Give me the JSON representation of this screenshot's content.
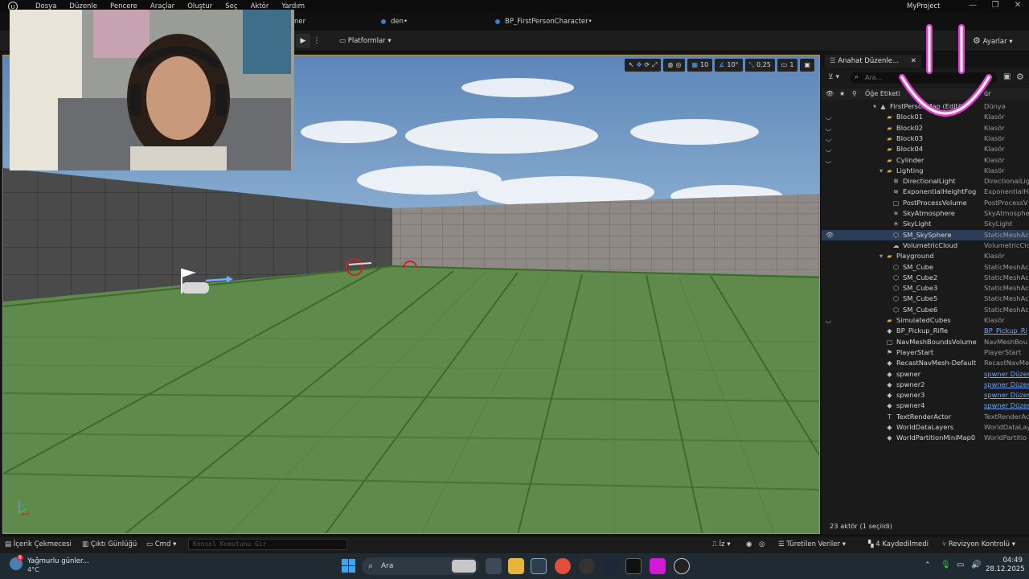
{
  "menu": [
    "Dosya",
    "Düzenle",
    "Pencere",
    "Araçlar",
    "Oluştur",
    "Seç",
    "Aktör",
    "Yardım"
  ],
  "project_name": "MyProject",
  "tabs": [
    {
      "label": "ner"
    },
    {
      "label": "den•"
    },
    {
      "label": "BP_FirstPersonCharacter•"
    }
  ],
  "toolbar": {
    "platforms_label": "Platformlar",
    "settings_label": "Ayarlar"
  },
  "viewport_tools": {
    "grid_snap": "10",
    "rotation_snap": "10°",
    "scale_snap": "0,25",
    "camera_speed": "1"
  },
  "outliner": {
    "tab_label": "Anahat Düzenle...",
    "search_placeholder": "Ara...",
    "col_label": "Öğe Etiketi",
    "col_type_partial": "ür",
    "rows": [
      {
        "name": "FirstPersonMap (Editör)",
        "type": "Dünya",
        "indent": 0,
        "icon": "world",
        "eye": false
      },
      {
        "name": "Block01",
        "type": "Klasör",
        "indent": 1,
        "icon": "folder",
        "eye": true
      },
      {
        "name": "Block02",
        "type": "Klasör",
        "indent": 1,
        "icon": "folder",
        "eye": true
      },
      {
        "name": "Block03",
        "type": "Klasör",
        "indent": 1,
        "icon": "folder",
        "eye": true
      },
      {
        "name": "Block04",
        "type": "Klasör",
        "indent": 1,
        "icon": "folder",
        "eye": true
      },
      {
        "name": "Cylinder",
        "type": "Klasör",
        "indent": 1,
        "icon": "folder",
        "eye": true
      },
      {
        "name": "Lighting",
        "type": "Klasör",
        "indent": 1,
        "icon": "folder",
        "eye": false
      },
      {
        "name": "DirectionalLight",
        "type": "DirectionalLig",
        "indent": 2,
        "icon": "light",
        "eye": false
      },
      {
        "name": "ExponentialHeightFog",
        "type": "ExponentialHe",
        "indent": 2,
        "icon": "fog",
        "eye": false
      },
      {
        "name": "PostProcessVolume",
        "type": "PostProcessV",
        "indent": 2,
        "icon": "volume",
        "eye": false
      },
      {
        "name": "SkyAtmosphere",
        "type": "SkyAtmosphe",
        "indent": 2,
        "icon": "sky",
        "eye": false
      },
      {
        "name": "SkyLight",
        "type": "SkyLight",
        "indent": 2,
        "icon": "sky",
        "eye": false
      },
      {
        "name": "SM_SkySphere",
        "type": "StaticMeshAc",
        "indent": 2,
        "icon": "mesh",
        "eye": true,
        "selected": true
      },
      {
        "name": "VolumetricCloud",
        "type": "VolumetricClo",
        "indent": 2,
        "icon": "cloud",
        "eye": false
      },
      {
        "name": "Playground",
        "type": "Klasör",
        "indent": 1,
        "icon": "folder",
        "eye": false
      },
      {
        "name": "SM_Cube",
        "type": "StaticMeshAc",
        "indent": 2,
        "icon": "mesh",
        "eye": false
      },
      {
        "name": "SM_Cube2",
        "type": "StaticMeshAc",
        "indent": 2,
        "icon": "mesh",
        "eye": false
      },
      {
        "name": "SM_Cube3",
        "type": "StaticMeshAc",
        "indent": 2,
        "icon": "mesh",
        "eye": false
      },
      {
        "name": "SM_Cube5",
        "type": "StaticMeshAc",
        "indent": 2,
        "icon": "mesh",
        "eye": false
      },
      {
        "name": "SM_Cube6",
        "type": "StaticMeshAc",
        "indent": 2,
        "icon": "mesh",
        "eye": false
      },
      {
        "name": "SimulatedCubes",
        "type": "Klasör",
        "indent": 1,
        "icon": "folder",
        "eye": true
      },
      {
        "name": "BP_Pickup_Rifle",
        "type": "BP_Pickup_Ri",
        "indent": 1,
        "icon": "actor",
        "eye": false,
        "link": true
      },
      {
        "name": "NavMeshBoundsVolume",
        "type": "NavMeshBou",
        "indent": 1,
        "icon": "volume",
        "eye": false
      },
      {
        "name": "PlayerStart",
        "type": "PlayerStart",
        "indent": 1,
        "icon": "flag",
        "eye": false
      },
      {
        "name": "RecastNavMesh-Default",
        "type": "RecastNavMe",
        "indent": 1,
        "icon": "actor",
        "eye": false
      },
      {
        "name": "spwner",
        "type": "spwner Düzer",
        "indent": 1,
        "icon": "actor",
        "eye": false,
        "link": true
      },
      {
        "name": "spwner2",
        "type": "spwner Düzer",
        "indent": 1,
        "icon": "actor",
        "eye": false,
        "link": true
      },
      {
        "name": "spwner3",
        "type": "spwner Düzer",
        "indent": 1,
        "icon": "actor",
        "eye": false,
        "link": true
      },
      {
        "name": "spwner4",
        "type": "spwner Düzer",
        "indent": 1,
        "icon": "actor",
        "eye": false,
        "link": true
      },
      {
        "name": "TextRenderActor",
        "type": "TextRenderAc",
        "indent": 1,
        "icon": "text",
        "eye": false
      },
      {
        "name": "WorldDataLayers",
        "type": "WorldDataLay",
        "indent": 1,
        "icon": "actor",
        "eye": false
      },
      {
        "name": "WorldPartitionMiniMap0",
        "type": "WorldPartitio",
        "indent": 1,
        "icon": "actor",
        "eye": false
      }
    ],
    "footer": "23 aktör (1 seçildi)"
  },
  "editor_bottom": {
    "content_drawer": "İçerik Çekmecesi",
    "output_log": "Çıktı Günlüğü",
    "cmd": "Cmd",
    "console_placeholder": "Konsol Komutunu Gir",
    "trace": "İz",
    "derived_data": "Türetilen Veriler",
    "unsaved": "4 Kaydedilmedi",
    "revision_control": "Revizyon Kontrolü"
  },
  "taskbar": {
    "weather_text": "Yağmurlu günler...",
    "weather_temp": "4°C",
    "search_label": "Ara",
    "time": "04:49",
    "date": "28.12.2025"
  },
  "colors": {
    "accent_blue": "#3a7bd5",
    "viewport_border": "#c08d2a",
    "overlay_pink": "#e23fd0"
  }
}
